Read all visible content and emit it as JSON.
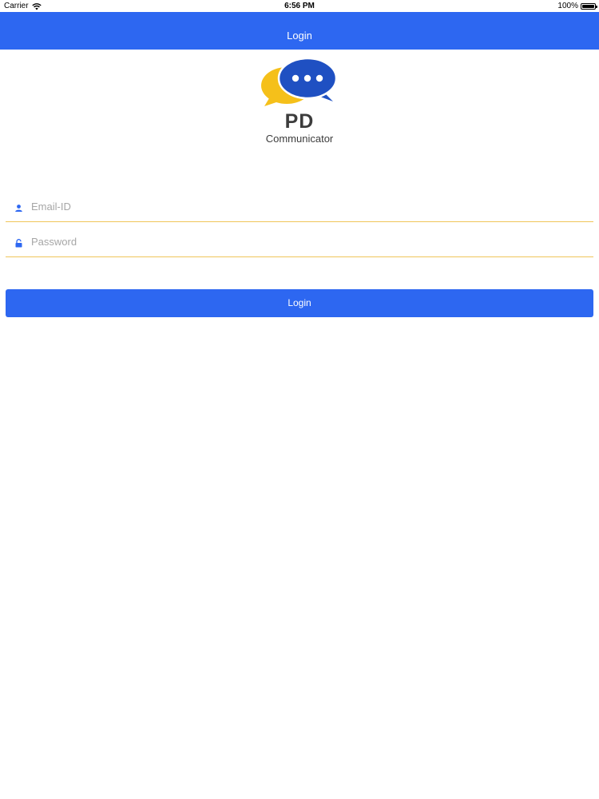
{
  "status_bar": {
    "carrier": "Carrier",
    "time": "6:56 PM",
    "battery": "100%",
    "battery_level": 1.0,
    "wifi_icon": "wifi-icon",
    "battery_icon": "battery-icon"
  },
  "nav": {
    "title": "Login"
  },
  "logo": {
    "icon": "chat-bubbles-logo",
    "title": "PD",
    "subtitle": "Communicator",
    "colors": {
      "blue_bubble": "#1f50c2",
      "yellow_bubble": "#f5c01a"
    }
  },
  "form": {
    "email": {
      "icon": "user-icon",
      "placeholder": "Email-ID",
      "value": ""
    },
    "password": {
      "icon": "lock-icon",
      "placeholder": "Password",
      "value": ""
    },
    "submit_label": "Login"
  },
  "colors": {
    "accent": "#2d67f1",
    "field_underline": "#f0c65a",
    "placeholder": "#a6a6a6"
  }
}
